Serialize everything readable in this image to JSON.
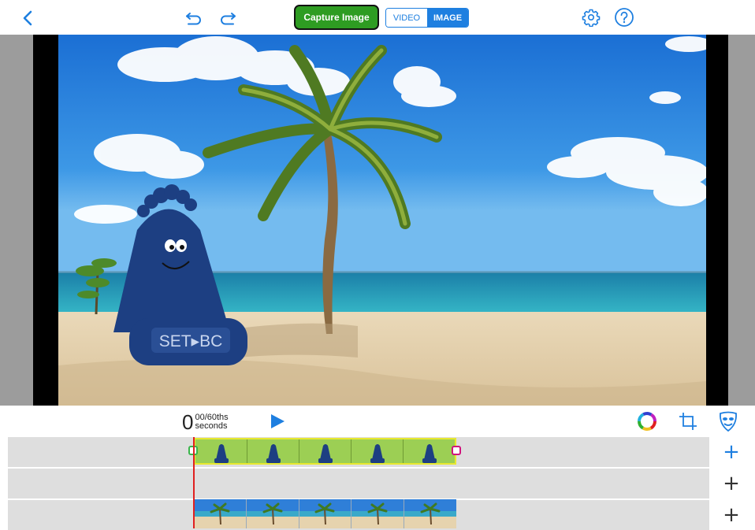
{
  "toolbar": {
    "capture_label": "Capture Image",
    "mode_video": "VIDEO",
    "mode_image": "IMAGE",
    "icons": [
      "back-icon",
      "undo-icon",
      "redo-icon",
      "settings-gear-icon",
      "help-icon"
    ]
  },
  "stage": {
    "scene": "beach-background",
    "character_text": "SET▸BC"
  },
  "playback": {
    "time_value": "0",
    "time_fraction": "00/60ths",
    "time_unit": "seconds",
    "icons": [
      "play-icon",
      "color-wheel-icon",
      "crop-icon",
      "mask-icon"
    ]
  },
  "timeline": {
    "track_add_icons": [
      "plus-icon",
      "plus-icon",
      "plus-icon"
    ],
    "character_clip_frames": 5,
    "background_clip_frames": 5
  },
  "colors": {
    "accent_blue": "#1e7fe0",
    "capture_green": "#2e9c22",
    "playhead_red": "#e02020",
    "clip_yellow": "#e8e830",
    "clip_start_marker": "#39b54a",
    "clip_end_marker": "#d0147c"
  }
}
